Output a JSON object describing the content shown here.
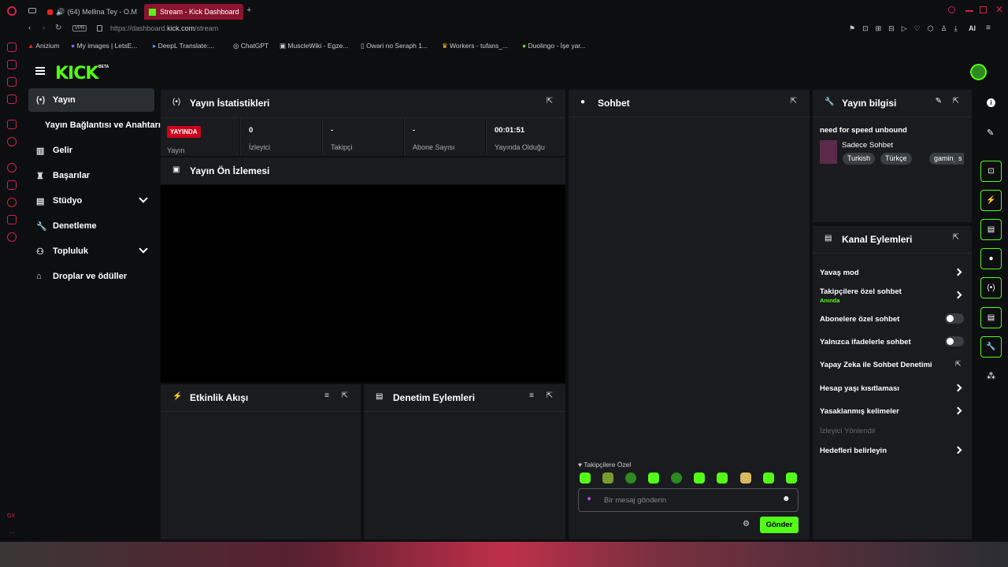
{
  "browser": {
    "tabs": [
      {
        "label": "(64) Mellina Tey - O.M"
      },
      {
        "label": "Stream - Kick Dashboard"
      }
    ],
    "url_prefix": "https://dashboard.",
    "url_domain": "kick.com",
    "url_path": "/stream",
    "vpn_label": "VPN",
    "ai_label": "AI",
    "bookmarks": [
      "Anizium",
      "My images | LetsE...",
      "DeepL Translate:...",
      "ChatGPT",
      "MuscleWiki - Egze...",
      "Owari no Seraph 1...",
      "Workers - tufans_...",
      "Duolingo - İşe yar..."
    ]
  },
  "header": {
    "logo": "KICK",
    "beta": "BETA"
  },
  "nav": {
    "items": [
      {
        "label": "Yayın"
      },
      {
        "label": "Yayın Bağlantısı ve Anahtarı"
      },
      {
        "label": "Gelir"
      },
      {
        "label": "Başarılar"
      },
      {
        "label": "Stüdyo"
      },
      {
        "label": "Denetleme"
      },
      {
        "label": "Topluluk"
      },
      {
        "label": "Droplar ve ödüller"
      }
    ]
  },
  "stats": {
    "title": "Yayın İstatistikleri",
    "live_badge": "YAYINDA",
    "live_label": "Yayın",
    "items": [
      {
        "value": "0",
        "label": "İzleyici"
      },
      {
        "value": "-",
        "label": "Takipçi"
      },
      {
        "value": "-",
        "label": "Abone Sayısı"
      },
      {
        "value": "00:01:51",
        "label": "Yayında Olduğu"
      }
    ]
  },
  "preview": {
    "title": "Yayın Ön İzlemesi"
  },
  "activity": {
    "title": "Etkinlik Akışı"
  },
  "moderation": {
    "title": "Denetim Eylemleri"
  },
  "chat": {
    "title": "Sohbet",
    "mode_label": "Takipçilere Özel",
    "placeholder": "Bir mesaj gönderin",
    "send_label": "Gönder"
  },
  "stream_info": {
    "title": "Yayın bilgisi",
    "stream_title": "need for speed unbound",
    "category": "Sadece Sohbet",
    "tags": [
      "Turkish",
      "Türkçe",
      "gaming",
      "s"
    ]
  },
  "channel_actions": {
    "title": "Kanal Eylemleri",
    "slow_mode": "Yavaş mod",
    "followers_only": "Takipçilere özel sohbet",
    "followers_only_status": "Anında",
    "subscribers_only": "Abonelere özel sohbet",
    "emotes_only": "Yalnızca ifadelerle sohbet",
    "ai_moderation": "Yapay Zeka ile Sohbet Denetimi",
    "account_age": "Hesap yaşı kısıtlaması",
    "banned_words": "Yasaklanmış kelimeler",
    "viewer_redirect": "İzleyici Yönlendir",
    "set_goals": "Hedefleri belirleyin"
  },
  "colors": {
    "accent": "#53fc18",
    "live": "#d0021b",
    "panel": "#191b1f",
    "bg": "#0d0e10"
  },
  "sidebar_bottom": "GX"
}
